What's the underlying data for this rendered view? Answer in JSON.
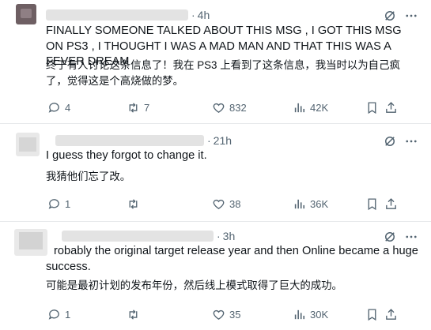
{
  "tweets": [
    {
      "time": "4h",
      "text": "FINALLY SOMEONE TALKED ABOUT THIS MSG , I GOT THIS MSG ON PS3 , I THOUGHT I WAS A MAD MAN AND THAT THIS WAS A FEVER DREAM",
      "translation_line1": "终于有人讨论这条信息了！我在 PS3 上看到了这条信息，我当时以为自己疯",
      "translation_line2": "了，觉得这是个高烧做的梦。",
      "replies": "4",
      "reposts": "7",
      "likes": "832",
      "views": "42K"
    },
    {
      "time": "21h",
      "text": "I guess they forgot to change it.",
      "translation_line1": "我猜他们忘了改。",
      "replies": "1",
      "reposts": "",
      "likes": "38",
      "views": "36K"
    },
    {
      "time": "3h",
      "text_line1": "robably the original target release year and then Online became a huge",
      "text_line2": "success.",
      "translation_line1": "可能是最初计划的发布年份，然后线上模式取得了巨大的成功。",
      "replies": "1",
      "reposts": "",
      "likes": "35",
      "views": "30K"
    }
  ],
  "icons": {
    "translate": "translate-icon",
    "reply": "reply-icon",
    "repost": "repost-icon",
    "like": "like-icon",
    "views": "views-icon",
    "bookmark": "bookmark-icon",
    "share": "share-icon"
  },
  "colors": {
    "icon_gray": "#536471",
    "text": "#0f1419",
    "divider": "#e6e9eb"
  }
}
